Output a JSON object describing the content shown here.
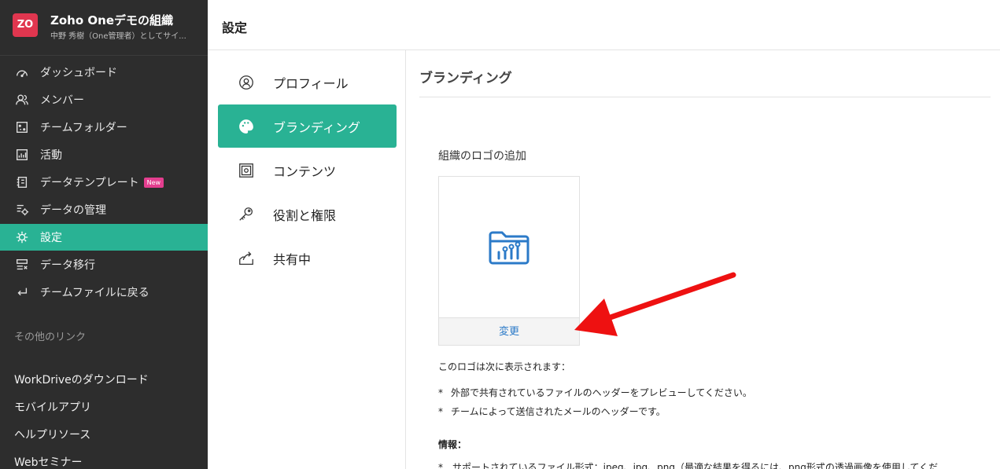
{
  "org": {
    "badge": "ZO",
    "name": "Zoho Oneデモの組織",
    "subtitle": "中野 秀樹（One管理者）としてサイ..."
  },
  "sidebar": {
    "items": [
      {
        "label": "ダッシュボード",
        "icon": "dashboard-icon"
      },
      {
        "label": "メンバー",
        "icon": "members-icon"
      },
      {
        "label": "チームフォルダー",
        "icon": "team-folder-icon"
      },
      {
        "label": "活動",
        "icon": "activity-icon"
      },
      {
        "label": "データテンプレート",
        "icon": "data-template-icon",
        "badge": "New"
      },
      {
        "label": "データの管理",
        "icon": "data-management-icon"
      },
      {
        "label": "設定",
        "icon": "settings-icon",
        "active": true
      },
      {
        "label": "データ移行",
        "icon": "data-migration-icon"
      },
      {
        "label": "チームファイルに戻る",
        "icon": "back-icon"
      }
    ],
    "other_links_title": "その他のリンク",
    "links": [
      "WorkDriveのダウンロード",
      "モバイルアプリ",
      "ヘルプリソース",
      "Webセミナー"
    ]
  },
  "header": {
    "title": "設定"
  },
  "settings_menu": {
    "items": [
      {
        "label": "プロフィール",
        "icon": "profile-icon"
      },
      {
        "label": "ブランディング",
        "icon": "palette-icon",
        "active": true
      },
      {
        "label": "コンテンツ",
        "icon": "content-icon"
      },
      {
        "label": "役割と権限",
        "icon": "key-icon"
      },
      {
        "label": "共有中",
        "icon": "share-icon"
      }
    ]
  },
  "branding": {
    "title": "ブランディング",
    "logo_heading": "組織のロゴの追加",
    "change_label": "変更",
    "shown_title": "このロゴは次に表示されます：",
    "bullets": [
      "外部で共有されているファイルのヘッダーをプレビューしてください。",
      "チームによって送信されたメールのヘッダーです。"
    ],
    "bullet_mark": "*",
    "info_title": "情報：",
    "info_line": "*　サポートされているファイル形式：jpeg、jpg、png（最適な結果を得るには、png形式の透過画像を使用してくだ"
  },
  "colors": {
    "sidebar_bg": "#2d2d2d",
    "accent": "#29b294",
    "badge_red": "#e0364f",
    "new_badge": "#e43e8f",
    "link_blue": "#2b7ac8",
    "arrow_red": "#ee1111"
  }
}
